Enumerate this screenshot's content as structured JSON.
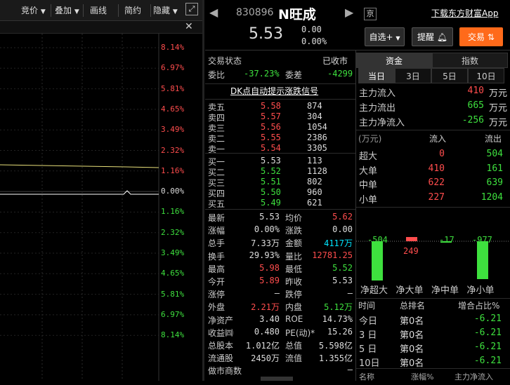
{
  "toolbar": {
    "items": [
      "竞价",
      "叠加",
      "画线",
      "简约",
      "隐藏"
    ],
    "expand_icon": "expand-icon"
  },
  "chart": {
    "pct_labels": [
      "8.14%",
      "6.97%",
      "5.81%",
      "4.65%",
      "3.49%",
      "2.32%",
      "1.16%",
      "0.00%",
      "1.16%",
      "2.32%",
      "3.49%",
      "4.65%",
      "5.81%",
      "6.97%",
      "8.14%"
    ],
    "close_icon": "close-icon"
  },
  "header": {
    "code": "830896",
    "name": "N旺成",
    "exchange": "京",
    "price": "5.53",
    "change": "0.00",
    "change_pct": "0.00%",
    "download_link": "下载东方财富App",
    "buttons": {
      "watchlist": "自选",
      "alert": "提醒",
      "trade": "交易"
    }
  },
  "status": {
    "label": "交易状态",
    "value": "已收市"
  },
  "ratio": {
    "wb_label": "委比",
    "wb_value": "-37.23%",
    "wc_label": "委差",
    "wc_value": "-4299"
  },
  "signal": "DK点自动提示涨跌信号",
  "sells": [
    {
      "label": "卖五",
      "price": "5.58",
      "vol": "874"
    },
    {
      "label": "卖四",
      "price": "5.57",
      "vol": "304"
    },
    {
      "label": "卖三",
      "price": "5.56",
      "vol": "1054"
    },
    {
      "label": "卖二",
      "price": "5.55",
      "vol": "2386"
    },
    {
      "label": "卖一",
      "price": "5.54",
      "vol": "3305"
    }
  ],
  "buys": [
    {
      "label": "买一",
      "price": "5.53",
      "vol": "113"
    },
    {
      "label": "买二",
      "price": "5.52",
      "vol": "1128"
    },
    {
      "label": "买三",
      "price": "5.51",
      "vol": "802"
    },
    {
      "label": "买四",
      "price": "5.50",
      "vol": "960"
    },
    {
      "label": "买五",
      "price": "5.49",
      "vol": "621"
    }
  ],
  "quote": [
    {
      "l1": "最新",
      "v1": "5.53",
      "c1": "w",
      "l2": "均价",
      "v2": "5.62",
      "c2": "r"
    },
    {
      "l1": "涨幅",
      "v1": "0.00%",
      "c1": "w",
      "l2": "涨跌",
      "v2": "0.00",
      "c2": "w"
    },
    {
      "l1": "总手",
      "v1": "7.33万",
      "c1": "w",
      "l2": "金额",
      "v2": "4117万",
      "c2": "c"
    },
    {
      "l1": "换手",
      "v1": "29.93%",
      "c1": "w",
      "l2": "量比",
      "v2": "12781.25",
      "c2": "r"
    },
    {
      "l1": "最高",
      "v1": "5.98",
      "c1": "r",
      "l2": "最低",
      "v2": "5.52",
      "c2": "g"
    },
    {
      "l1": "今开",
      "v1": "5.89",
      "c1": "r",
      "l2": "昨收",
      "v2": "5.53",
      "c2": "w"
    },
    {
      "l1": "涨停",
      "v1": "—",
      "c1": "w",
      "l2": "跌停",
      "v2": "—",
      "c2": "w"
    },
    {
      "l1": "外盘",
      "v1": "2.21万",
      "c1": "r",
      "l2": "内盘",
      "v2": "5.12万",
      "c2": "g"
    },
    {
      "l1": "净资产",
      "v1": "3.40",
      "c1": "w",
      "l2": "ROE",
      "v2": "14.73%",
      "c2": "w"
    },
    {
      "l1": "收益㈣",
      "v1": "0.480",
      "c1": "w",
      "l2": "PE(动)*",
      "v2": "15.26",
      "c2": "w"
    },
    {
      "l1": "总股本",
      "v1": "1.012亿",
      "c1": "w",
      "l2": "总值",
      "v2": "5.598亿",
      "c2": "w"
    },
    {
      "l1": "流通股",
      "v1": "2450万",
      "c1": "w",
      "l2": "流值",
      "v2": "1.355亿",
      "c2": "w"
    },
    {
      "l1": "做市商数",
      "v1": "",
      "c1": "w",
      "l2": "",
      "v2": "—",
      "c2": "w"
    }
  ],
  "fund": {
    "tabs": [
      "资金",
      "指数"
    ],
    "periods": [
      "当日",
      "3日",
      "5日",
      "10日"
    ],
    "flows": [
      {
        "label": "主力流入",
        "value": "410",
        "unit": "万元",
        "c": "r"
      },
      {
        "label": "主力流出",
        "value": "665",
        "unit": "万元",
        "c": "g"
      },
      {
        "label": "主力净流入",
        "value": "-256",
        "unit": "万元",
        "c": "g"
      }
    ],
    "table_head": [
      "(万元)",
      "流入",
      "流出"
    ],
    "table": [
      {
        "label": "超大",
        "in": "0",
        "out": "504"
      },
      {
        "label": "大单",
        "in": "410",
        "out": "161"
      },
      {
        "label": "中单",
        "in": "622",
        "out": "639"
      },
      {
        "label": "小单",
        "in": "227",
        "out": "1204"
      }
    ],
    "net_labels": [
      "-504",
      "249",
      "-17",
      "-977"
    ],
    "net_names": [
      "净超大",
      "净大单",
      "净中单",
      "净小单"
    ],
    "rank_head": [
      "时间",
      "总排名",
      "增合占比%"
    ],
    "ranks": [
      {
        "t": "今日",
        "r": "第0名",
        "p": "-6.21"
      },
      {
        "t": "3 日",
        "r": "第0名",
        "p": "-6.21"
      },
      {
        "t": "5 日",
        "r": "第0名",
        "p": "-6.21"
      },
      {
        "t": "10日",
        "r": "第0名",
        "p": "-6.21"
      }
    ],
    "bottom_head": [
      "名称",
      "涨幅%",
      "主力净流入"
    ]
  },
  "colors": {
    "up": "#ff4d4d",
    "down": "#3ee03e",
    "accent": "#ff6a1a",
    "cyan": "#00e5ff"
  }
}
